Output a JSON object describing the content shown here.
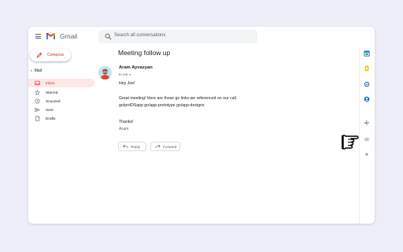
{
  "app": {
    "brand": "Gmail"
  },
  "search": {
    "placeholder": "Search all conversations"
  },
  "compose": {
    "label": "Compose"
  },
  "sidebar": {
    "section": "Mail",
    "items": [
      {
        "label": "Inbox",
        "icon": "inbox-icon",
        "active": true
      },
      {
        "label": "Starred",
        "icon": "star-icon",
        "active": false
      },
      {
        "label": "Snoozed",
        "icon": "clock-icon",
        "active": false
      },
      {
        "label": "Sent",
        "icon": "send-icon",
        "active": false
      },
      {
        "label": "Drafts",
        "icon": "draft-icon",
        "active": false
      }
    ]
  },
  "email": {
    "subject": "Meeting follow up",
    "sender": "Aram Ayvazyan",
    "recipient": "to me",
    "greeting": "Hey Joe!",
    "body_line1": "Great meeting! Here are those go links we referenced on our call.",
    "body_line2": "go/prdOSapp go/app-prototype go/app-designs",
    "closing": "Thanks!",
    "signature": "Aram"
  },
  "actions": {
    "reply": "Reply",
    "forward": "Forward"
  },
  "right_rail": {
    "icons": [
      "calendar-icon",
      "keep-icon",
      "tasks-icon",
      "contacts-icon",
      "slack-icon",
      "eye-icon",
      "add-icon"
    ]
  },
  "colors": {
    "accent_red": "#d93025",
    "active_bg": "#fce8e6",
    "page_bg": "#eeeef8"
  }
}
